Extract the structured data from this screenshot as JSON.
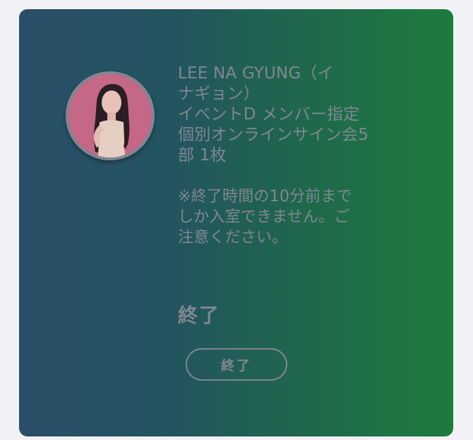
{
  "ticket": {
    "title_lines": [
      "LEE NA GYUNG（イ",
      "ナギョン）",
      "イベントD メンバー指定",
      "個別オンラインサイン会5",
      "部 1枚"
    ],
    "notice_lines": [
      "※終了時間の10分前まで",
      "しか入室できません。ご",
      "注意ください。"
    ],
    "status": "終了",
    "button_label": "終了"
  },
  "colors": {
    "card_gradient_start": "#2a4e69",
    "card_gradient_end": "#1d7b3e",
    "muted_text": "#7f8790",
    "page_background": "#f2f2f6"
  },
  "icons": {
    "avatar": "member-photo"
  }
}
